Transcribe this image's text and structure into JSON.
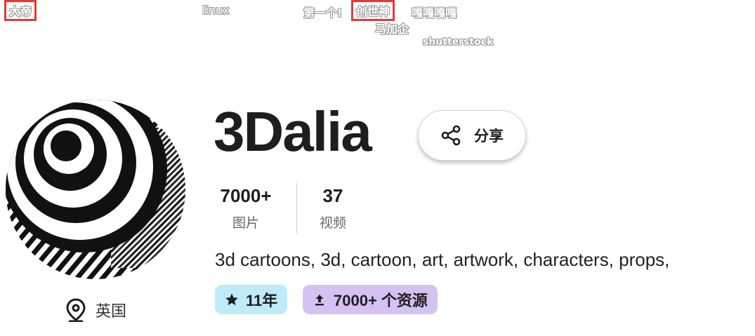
{
  "overlay": {
    "label_1": "大帝",
    "label_2": "linux",
    "label_3": "第一个!",
    "label_4": "创世神",
    "label_5": "嘎嘎嘎嘎",
    "label_6": "马加企",
    "label_7": "shutterstock"
  },
  "profile": {
    "name": "3Dalia",
    "share_label": "分享",
    "location": "英国",
    "stats": [
      {
        "value": "7000+",
        "caption": "图片"
      },
      {
        "value": "37",
        "caption": "视频"
      }
    ],
    "tags": "3d cartoons, 3d, cartoon, art, artwork, characters, props,",
    "badges": {
      "years": "11年",
      "assets": "7000+ 个资源"
    }
  },
  "icons": {
    "share": "share-icon",
    "location": "map-pin-icon",
    "star": "star-icon",
    "upload": "upload-icon"
  },
  "colors": {
    "years_badge": "#bfeaf7",
    "assets_badge": "#d4c2f3",
    "highlight_box": "#e53935"
  }
}
